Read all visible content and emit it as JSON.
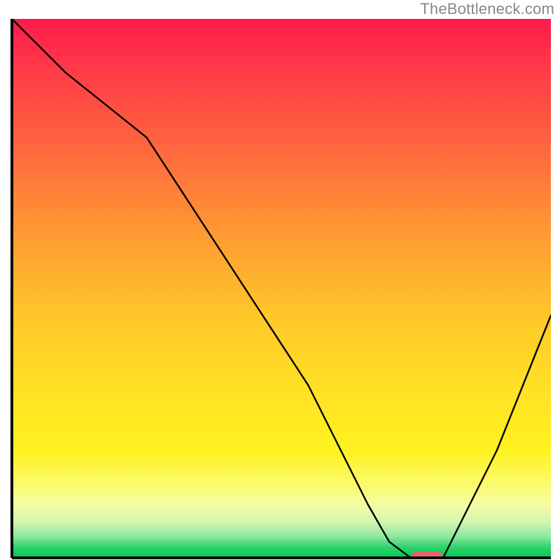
{
  "watermark": "TheBottleneck.com",
  "chart_data": {
    "type": "line",
    "title": "",
    "xlabel": "",
    "ylabel": "",
    "xlim": [
      0,
      100
    ],
    "ylim": [
      0,
      100
    ],
    "grid": false,
    "legend": false,
    "x": [
      0,
      10,
      25,
      40,
      55,
      60,
      66,
      70,
      74,
      80,
      90,
      100
    ],
    "values": [
      100,
      90,
      78,
      55,
      32,
      22,
      10,
      3,
      0,
      0,
      20,
      45
    ],
    "marker": {
      "x": 77,
      "value": 0,
      "color": "#e06666"
    },
    "gradient_stops": [
      {
        "pct": 0,
        "color": "#ff1a4b"
      },
      {
        "pct": 10,
        "color": "#ff3c47"
      },
      {
        "pct": 25,
        "color": "#ff6a3d"
      },
      {
        "pct": 40,
        "color": "#ff9a33"
      },
      {
        "pct": 55,
        "color": "#ffc72a"
      },
      {
        "pct": 70,
        "color": "#ffe324"
      },
      {
        "pct": 80,
        "color": "#fff220"
      },
      {
        "pct": 85,
        "color": "#fcf95a"
      },
      {
        "pct": 90,
        "color": "#f5fca0"
      },
      {
        "pct": 93,
        "color": "#d9f7b0"
      },
      {
        "pct": 96,
        "color": "#8fe8a0"
      },
      {
        "pct": 98,
        "color": "#2fd36b"
      },
      {
        "pct": 100,
        "color": "#00c853"
      }
    ]
  }
}
